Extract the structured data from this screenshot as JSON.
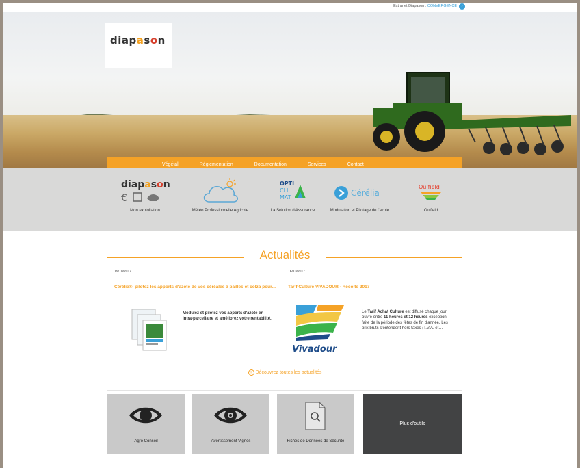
{
  "header": {
    "extranet_label": "Extranet Diapason : ",
    "extranet_link": "CONVERGENCE",
    "logo": "diapason"
  },
  "nav": {
    "items": [
      "Végétal",
      "Réglementation",
      "Documentation",
      "Services",
      "Contact"
    ]
  },
  "tools": [
    {
      "label": "Mon exploitation",
      "icon": "diapason-exploitation-icon"
    },
    {
      "label": "Météo Professionnelle Agricole",
      "icon": "cloud-sun-icon"
    },
    {
      "label": "La Solution d'Assurance",
      "icon": "opticlimat-logo"
    },
    {
      "label": "Modulation et Pilotage de l'azote",
      "icon": "cerelia-logo"
    },
    {
      "label": "Oulfield",
      "icon": "oulfield-logo"
    }
  ],
  "tool_logos": {
    "opticlimat": [
      "OPTI",
      "CLI",
      "MAT"
    ],
    "cerelia": "Cérélia",
    "oulfield": "Oulfield",
    "diapason_small": "diapason"
  },
  "news": {
    "title": "Actualités",
    "items": [
      {
        "date": "19/10/2017",
        "headline": "Cérélia®, pilotez les apports d'azote de vos céréales à pailles et colza pour…",
        "body": "Modulez et pilotez vos apports d'azote en intra-parcellaire et améliorez votre rentabilité."
      },
      {
        "date": "16/10/2017",
        "headline": "Tarif Culture VIVADOUR - Récolte 2017",
        "body_parts": [
          "Le ",
          "Tarif Achat Culture",
          " est diffusé chaque jour ouvré entre ",
          "11 heures et 12 heures",
          " exception faite de la période des fêtes de fin d'année. Les prix bruts s'entendent hors taxes (T.V.A. et…"
        ],
        "logo_text": "Vivadour"
      }
    ],
    "discover_label": "Découvrez toutes les actualités"
  },
  "tiles": [
    {
      "label": "Agro Conseil",
      "icon": "eye-icon"
    },
    {
      "label": "Avertissement Vignes",
      "icon": "eye-icon"
    },
    {
      "label": "Fiches de Données de Sécurité",
      "icon": "document-search-icon"
    },
    {
      "label": "Plus d'outils",
      "icon": ""
    }
  ],
  "colors": {
    "accent": "#f5a226",
    "link": "#3aa0d8",
    "tile_bg": "#c9c9c9",
    "tile_dark": "#424344",
    "band_bg": "#d9d9d8"
  }
}
